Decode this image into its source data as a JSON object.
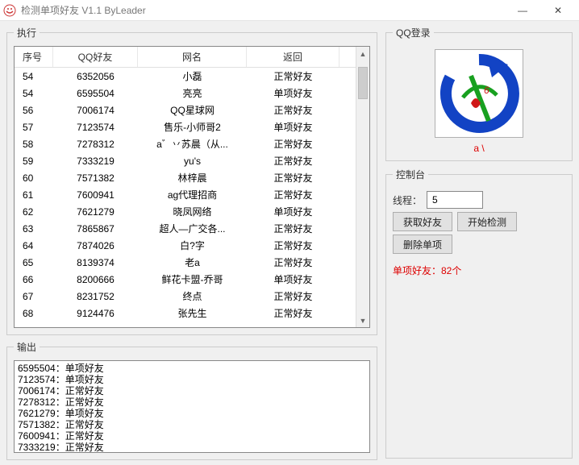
{
  "window": {
    "title": "检测单项好友  V1.1  ByLeader"
  },
  "groups": {
    "exec": "执行",
    "output": "输出",
    "login": "QQ登录",
    "console": "控制台"
  },
  "columns": {
    "seq": "序号",
    "qq": "QQ好友",
    "nick": "网名",
    "ret": "返回"
  },
  "rows": [
    {
      "seq": "54",
      "qq": "6352056",
      "nick": "小磊",
      "ret": "正常好友"
    },
    {
      "seq": "54",
      "qq": "6595504",
      "nick": "亮亮",
      "ret": "单项好友"
    },
    {
      "seq": "56",
      "qq": "7006174",
      "nick": "QQ星球网",
      "ret": "正常好友"
    },
    {
      "seq": "57",
      "qq": "7123574",
      "nick": "售乐-小师哥2",
      "ret": "单项好友"
    },
    {
      "seq": "58",
      "qq": "7278312",
      "nick": "a゛丷苏晨（从...",
      "ret": "正常好友"
    },
    {
      "seq": "59",
      "qq": "7333219",
      "nick": "yu's",
      "ret": "正常好友"
    },
    {
      "seq": "60",
      "qq": "7571382",
      "nick": "林梓晨",
      "ret": "正常好友"
    },
    {
      "seq": "61",
      "qq": "7600941",
      "nick": "ag代理招商",
      "ret": "正常好友"
    },
    {
      "seq": "62",
      "qq": "7621279",
      "nick": "晓凤网络",
      "ret": "单项好友"
    },
    {
      "seq": "63",
      "qq": "7865867",
      "nick": "超人—广交各...",
      "ret": "正常好友"
    },
    {
      "seq": "64",
      "qq": "7874026",
      "nick": "白?字",
      "ret": "正常好友"
    },
    {
      "seq": "65",
      "qq": "8139374",
      "nick": "老a",
      "ret": "正常好友"
    },
    {
      "seq": "66",
      "qq": "8200666",
      "nick": "鲜花卡盟-乔哥",
      "ret": "单项好友"
    },
    {
      "seq": "67",
      "qq": "8231752",
      "nick": "终点",
      "ret": "正常好友"
    },
    {
      "seq": "68",
      "qq": "9124476",
      "nick": "张先生",
      "ret": "正常好友"
    }
  ],
  "output_lines": "6595504：单项好友\n7123574：单项好友\n7006174：正常好友\n7278312：正常好友\n7621279：单项好友\n7571382：正常好友\n7600941：正常好友\n7333219：正常好友",
  "login": {
    "avatar_caption": "a \\"
  },
  "console": {
    "thread_label": "线程：",
    "thread_value": "5",
    "btn_fetch": "获取好友",
    "btn_start": "开始检测",
    "btn_delete": "删除单项",
    "status": "单项好友：82个"
  },
  "icons": {
    "minimize": "—",
    "close": "✕",
    "up": "▲",
    "down": "▼"
  }
}
